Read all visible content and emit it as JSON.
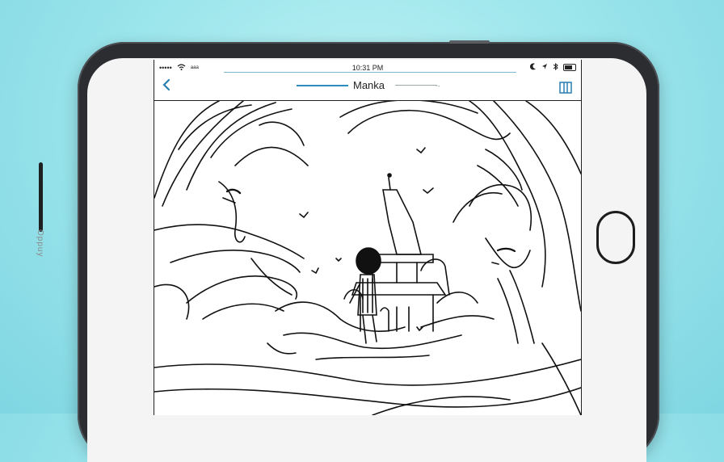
{
  "status_bar": {
    "carrier": "•••••",
    "signal_label": "ᵃᵃᵃ",
    "time": "10:31 PM",
    "right_icons": [
      "moon-icon",
      "location-icon",
      "bluetooth-icon",
      "battery-icon"
    ]
  },
  "nav": {
    "title": "Manka",
    "back_icon": "chevron-left-icon",
    "library_icon": "library-icon",
    "arrow_glyph": "→"
  },
  "device": {
    "side_label": "Oppuy"
  },
  "colors": {
    "background": "#9de6ec",
    "accent": "#2a8fbf",
    "ink": "#111111"
  }
}
